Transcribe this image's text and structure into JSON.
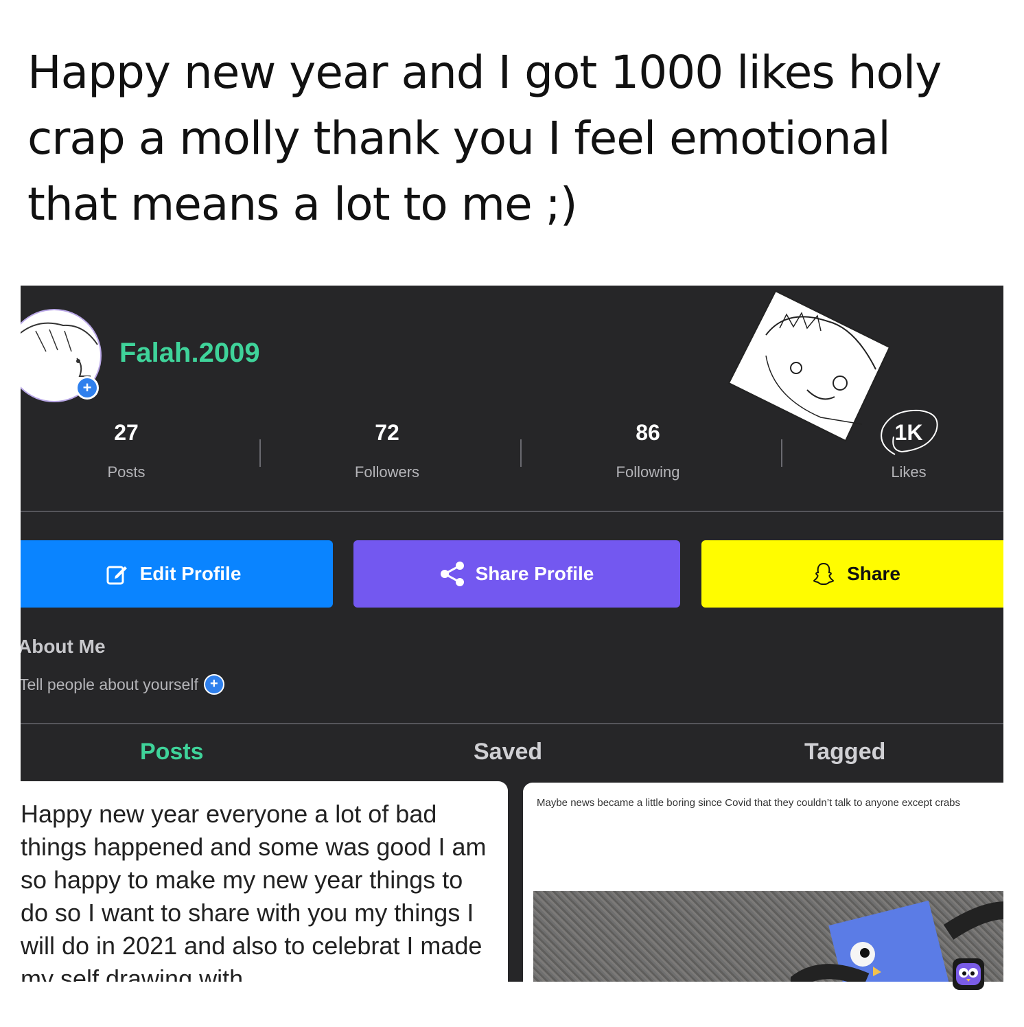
{
  "caption": "Happy new year and I got 1000 likes holy crap a molly thank you I feel emotional that means a lot to me ;)",
  "profile": {
    "username": "Falah.2009"
  },
  "stats": [
    {
      "value": "27",
      "label": "Posts"
    },
    {
      "value": "72",
      "label": "Followers"
    },
    {
      "value": "86",
      "label": "Following"
    },
    {
      "value": "1K",
      "label": "Likes"
    }
  ],
  "buttons": {
    "edit": "Edit Profile",
    "share_profile": "Share Profile",
    "share": "Share"
  },
  "about": {
    "heading": "About Me",
    "prompt": "Tell people about yourself"
  },
  "tabs": [
    "Posts",
    "Saved",
    "Tagged"
  ],
  "posts": [
    {
      "text": "Happy new year everyone a lot of bad things happened and some was good I am so happy to make my new year things to do so I want to share with you my things I will do in 2021 and also to celebrat I made my self drawing with"
    },
    {
      "text": "Maybe news became a little boring since Covid that they couldn’t talk to anyone except crabs"
    }
  ],
  "colors": {
    "background": "#262628",
    "username": "#3fd39a",
    "edit_button": "#0a84ff",
    "share_profile_button": "#7358f0",
    "snap_button": "#fffc00",
    "active_tab": "#3fd39a"
  }
}
